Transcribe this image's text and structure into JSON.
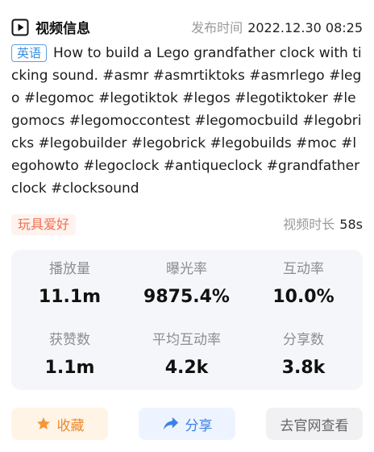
{
  "header": {
    "title": "视频信息",
    "publish_label": "发布时间",
    "publish_time": "2022.12.30 08:25"
  },
  "description": {
    "lang_tag": "英语",
    "text": "How to build a Lego grandfather clock with ticking sound. #asmr #asmrtiktoks #asmrlego #lego #legomoc #legotiktok #legos #legotiktoker #legomocs #legomoccontest #legomocbuild #legobricks #legobuilder #legobrick #legobuilds #moc #legohowto #legoclock #antiqueclock #grandfatherclock #clocksound"
  },
  "meta": {
    "category": "玩具爱好",
    "duration_label": "视频时长",
    "duration": "58s"
  },
  "stats": [
    {
      "label": "播放量",
      "value": "11.1m"
    },
    {
      "label": "曝光率",
      "value": "9875.4%"
    },
    {
      "label": "互动率",
      "value": "10.0%"
    },
    {
      "label": "获赞数",
      "value": "1.1m"
    },
    {
      "label": "平均互动率",
      "value": "4.2k"
    },
    {
      "label": "分享数",
      "value": "3.8k"
    }
  ],
  "actions": {
    "favorite": "收藏",
    "share": "分享",
    "visit_site": "去官网查看"
  },
  "colors": {
    "accent_blue": "#3b8fe0",
    "category_red": "#f06f4f",
    "favorite_orange": "#f08a2c"
  },
  "icons": {
    "title": "video-play-icon",
    "favorite": "star-icon",
    "share": "share-arrow-icon"
  }
}
